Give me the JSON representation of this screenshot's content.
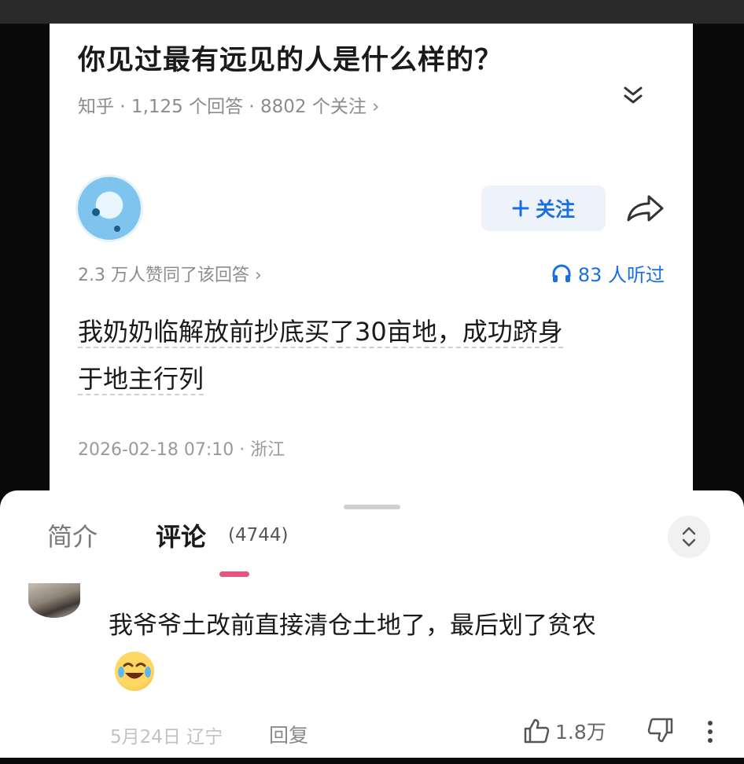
{
  "question": {
    "title": "你见过最有远见的人是什么样的？",
    "meta": "知乎 · 1,125 个回答 · 8802 个关注 ›"
  },
  "answer": {
    "follow_label": "关注",
    "agree_text": "2.3 万人赞同了该回答 ›",
    "listen_text": "83 人听过",
    "content_line1": "我奶奶临解放前抄底买了30亩地，成功跻身",
    "content_line2": "于地主行列",
    "timestamp": "2026-02-18 07:10 · 浙江"
  },
  "sheet": {
    "tab_intro": "简介",
    "tab_comment": "评论",
    "comment_count": "(4744)"
  },
  "comment": {
    "text": "我爷爷土改前直接清仓土地了，最后划了贫农",
    "date": "5月24日 辽宁",
    "reply_label": "回复",
    "like_count": "1.8万"
  },
  "colors": {
    "accent_blue": "#1a6fe0",
    "tab_indicator": "#e8547e"
  },
  "icons": [
    "chevron-double-down-icon",
    "plus-icon",
    "share-icon",
    "headphones-icon",
    "sort-icon",
    "thumbs-up-icon",
    "thumbs-down-icon",
    "more-vertical-icon",
    "laughing-crying-emoji-icon"
  ]
}
